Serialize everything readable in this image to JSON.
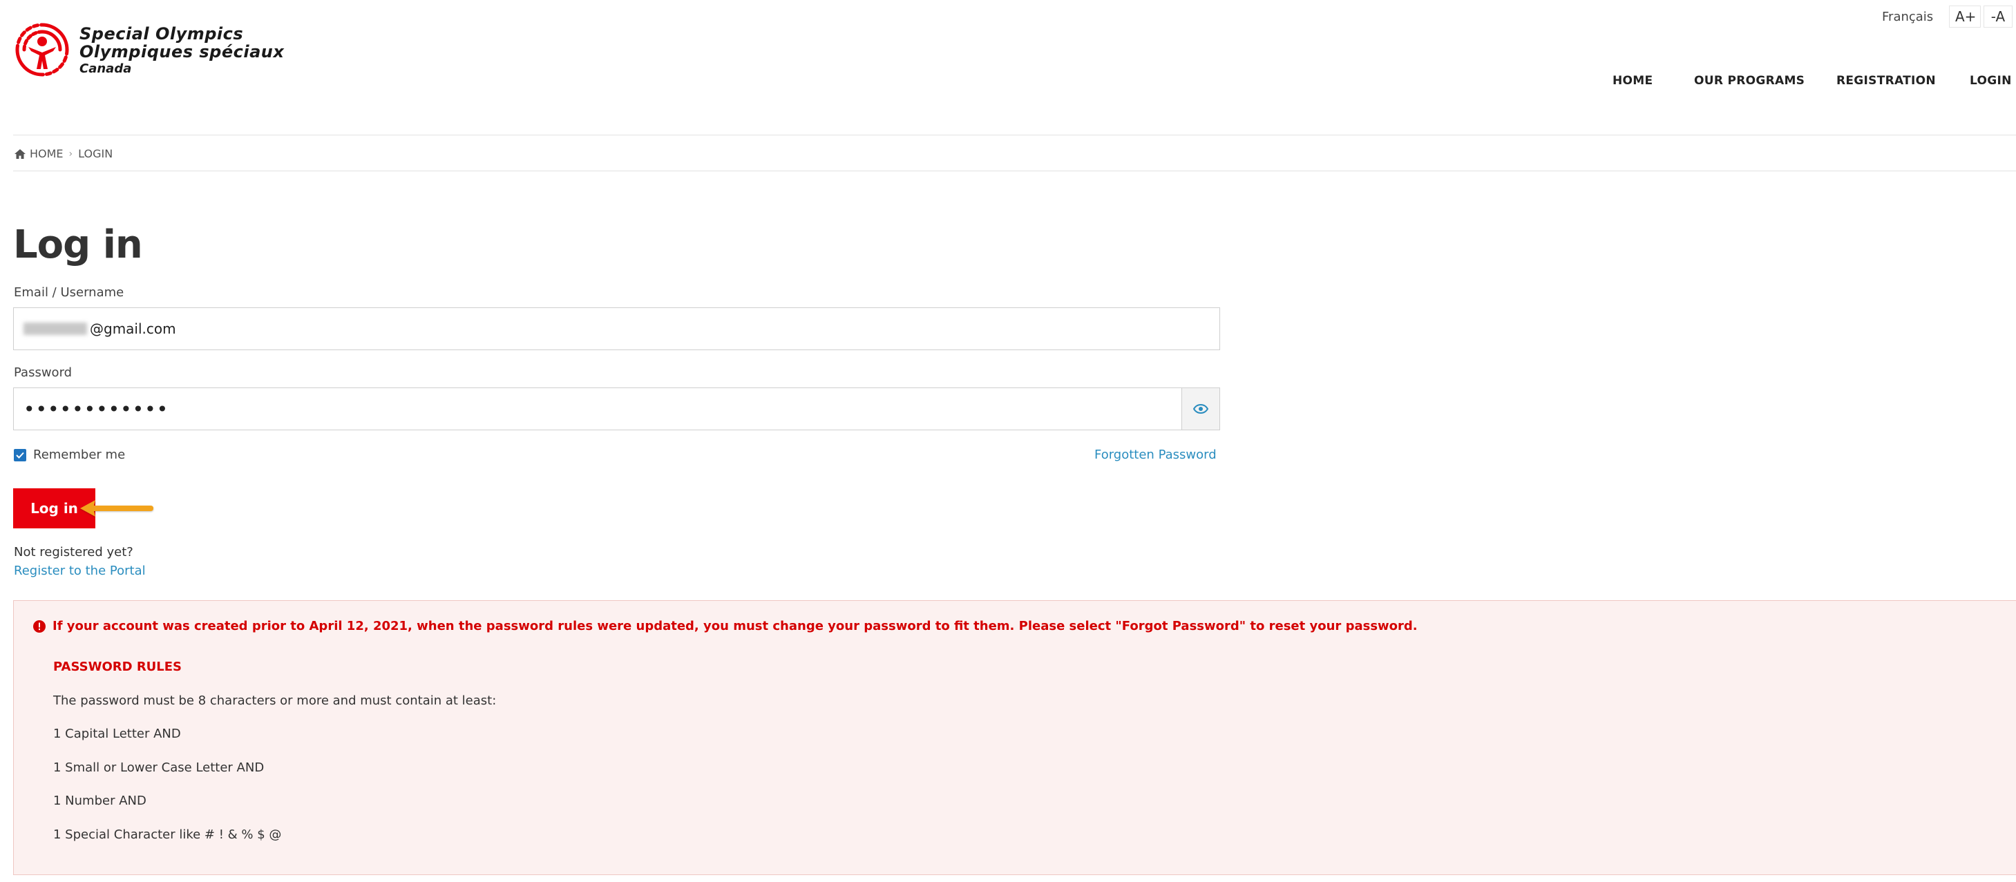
{
  "header": {
    "logo_line1": "Special Olympics",
    "logo_line2": "Olympiques spéciaux",
    "logo_line3": "Canada",
    "language_link": "Français",
    "font_increase": "A+",
    "font_decrease": "-A",
    "nav": [
      "HOME",
      "OUR PROGRAMS",
      "REGISTRATION",
      "LOGIN"
    ]
  },
  "breadcrumb": {
    "home": "HOME",
    "current": "LOGIN"
  },
  "form": {
    "title": "Log in",
    "email_label": "Email / Username",
    "email_value": "@gmail.com",
    "password_label": "Password",
    "password_value": "••••••••••••",
    "remember_label": "Remember me",
    "remember_checked": true,
    "forgot_link": "Forgotten Password",
    "submit_label": "Log in",
    "not_registered": "Not registered yet?",
    "register_link": "Register to the Portal"
  },
  "alert": {
    "message": "If your account was created prior to April 12, 2021, when the password rules were updated, you must change your password to fit them. Please select \"Forgot Password\" to reset your password.",
    "rules_title": "PASSWORD RULES",
    "rules_intro": "The password must be 8 characters or more and must contain at least:",
    "rules": [
      "1 Capital Letter AND",
      "1 Small or Lower Case Letter AND",
      "1 Number AND",
      "1 Special Character like # ! & % $ @"
    ]
  },
  "colors": {
    "brand_red": "#e8000d",
    "link_blue": "#2a8dbf",
    "alert_bg": "#fcf1f0",
    "arrow_orange": "#f2a31b"
  }
}
